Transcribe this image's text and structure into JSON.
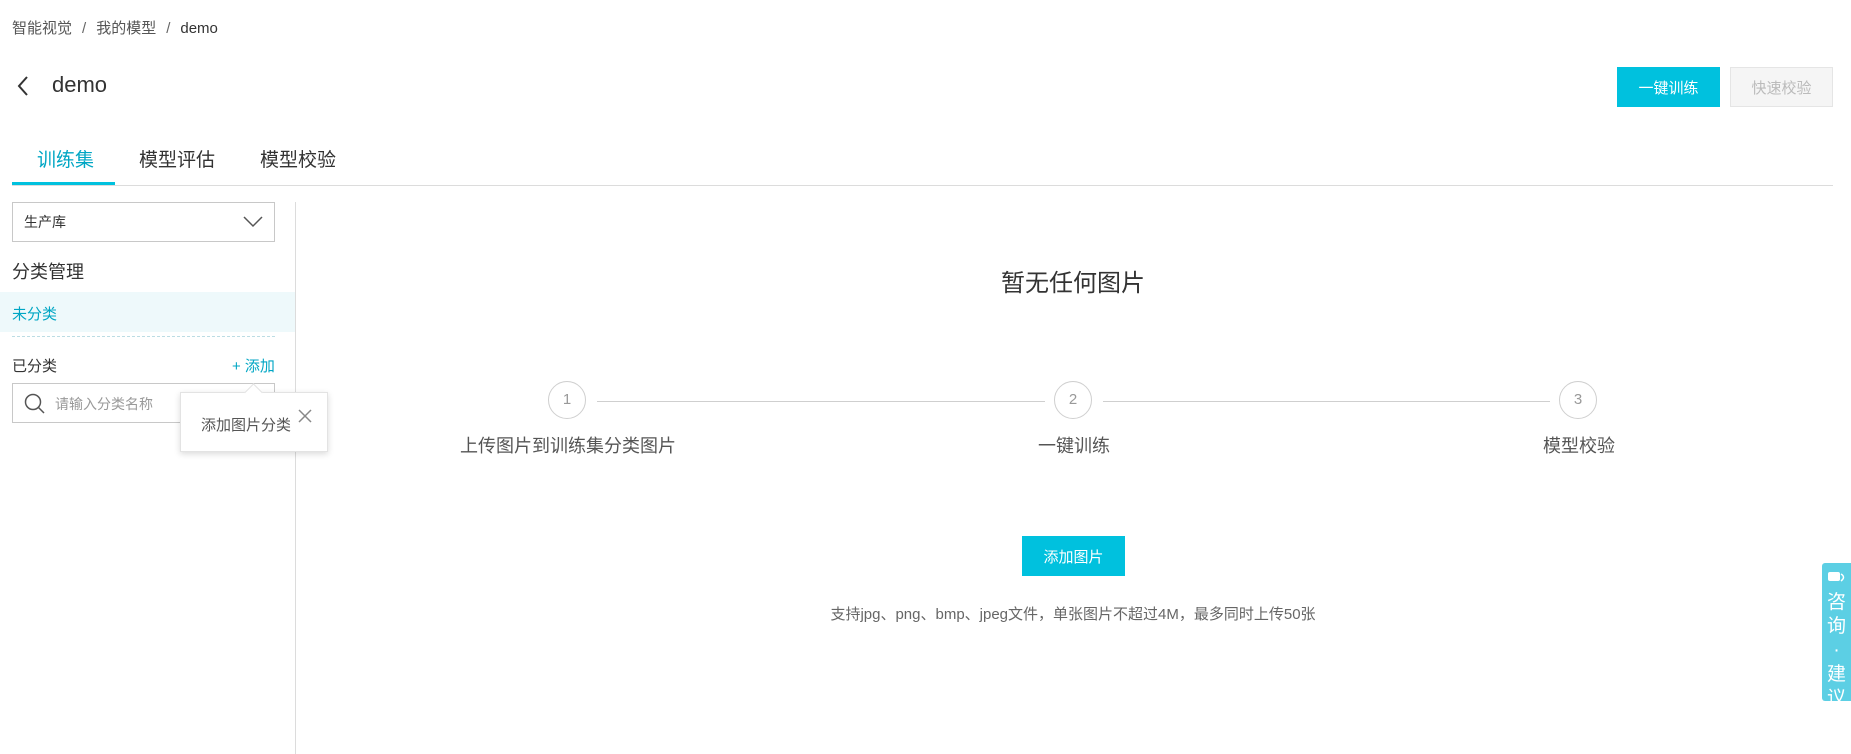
{
  "breadcrumb": {
    "items": [
      "智能视觉",
      "我的模型",
      "demo"
    ],
    "separator": "/"
  },
  "header": {
    "title": "demo",
    "train_button": "一键训练",
    "verify_button": "快速校验"
  },
  "tabs": [
    {
      "label": "训练集"
    },
    {
      "label": "模型评估"
    },
    {
      "label": "模型校验"
    }
  ],
  "sidebar": {
    "library_select": "生产库",
    "section_title": "分类管理",
    "uncategorized": "未分类",
    "categorized_label": "已分类",
    "add_link": "+ 添加",
    "search_placeholder": "请输入分类名称"
  },
  "tooltip": {
    "text": "添加图片分类"
  },
  "main": {
    "empty_title": "暂无任何图片",
    "steps": [
      {
        "number": "1",
        "label": "上传图片到训练集分类图片"
      },
      {
        "number": "2",
        "label": "一键训练"
      },
      {
        "number": "3",
        "label": "模型校验"
      }
    ],
    "add_button": "添加图片",
    "hint": "支持jpg、png、bmp、jpeg文件，单张图片不超过4M，最多同时上传50张"
  },
  "feedback": {
    "text": "咨询·建议"
  },
  "colors": {
    "accent": "#00c1de",
    "accent_text": "#00a6c4",
    "float_button": "#5ccfe4"
  },
  "icons": {
    "back": "chevron-left-icon",
    "select": "chevron-down-icon",
    "search": "search-icon",
    "close": "close-icon",
    "chat": "chat-icon"
  }
}
